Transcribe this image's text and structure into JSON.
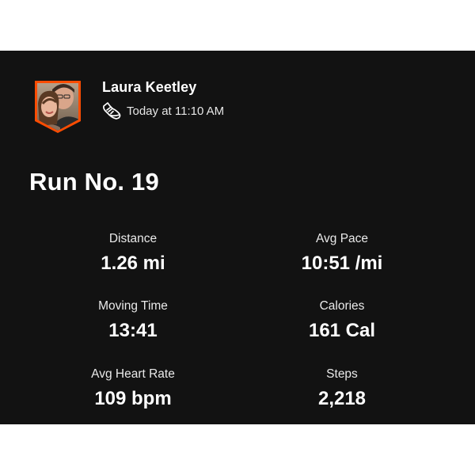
{
  "athlete": {
    "name": "Laura Keetley",
    "avatar_icon": "profile-photo-shield",
    "activity_icon": "running-shoe-icon",
    "timestamp": "Today at 11:10 AM"
  },
  "activity": {
    "title": "Run No. 19"
  },
  "stats": [
    {
      "label": "Distance",
      "value": "1.26 mi"
    },
    {
      "label": "Avg Pace",
      "value": "10:51 /mi"
    },
    {
      "label": "Moving Time",
      "value": "13:41"
    },
    {
      "label": "Calories",
      "value": "161 Cal"
    },
    {
      "label": "Avg Heart Rate",
      "value": "109 bpm"
    },
    {
      "label": "Steps",
      "value": "2,218"
    }
  ],
  "colors": {
    "background": "#121212",
    "accent": "#fc4c02",
    "text": "#ffffff"
  }
}
